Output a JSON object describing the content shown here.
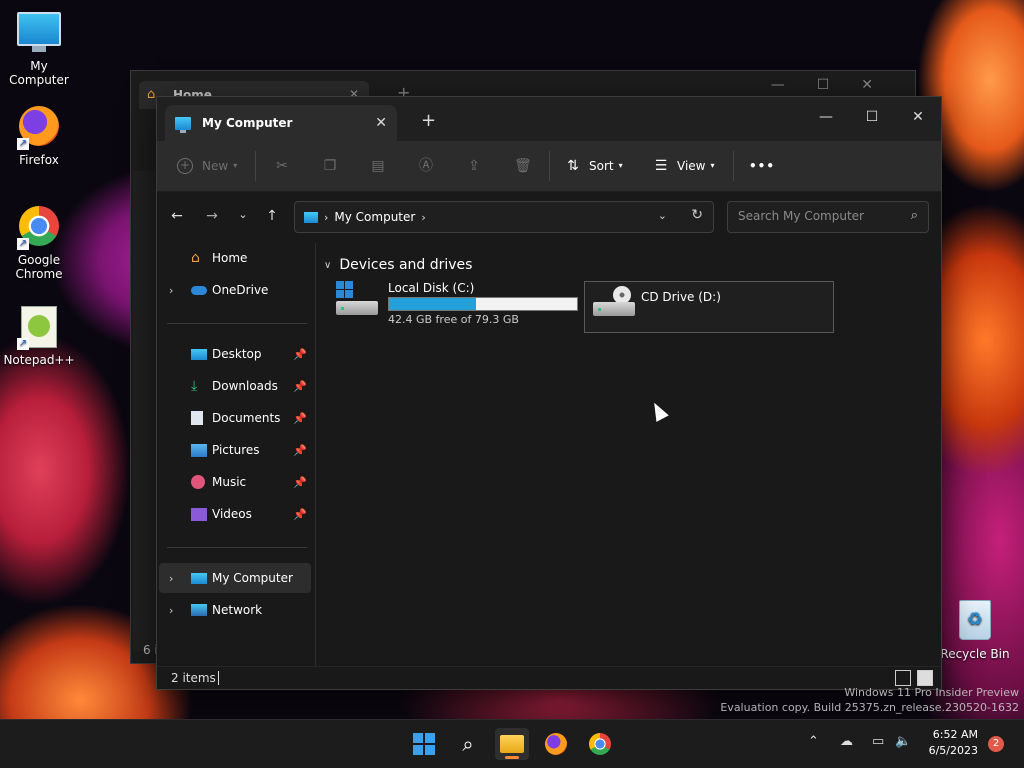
{
  "desktop": {
    "icons": [
      {
        "label": "My Computer"
      },
      {
        "label": "Firefox"
      },
      {
        "label": "Google Chrome"
      },
      {
        "label": "Notepad++"
      },
      {
        "label": "Recycle Bin"
      }
    ]
  },
  "back_window": {
    "tab_title": "Home",
    "status_partial": "6 i"
  },
  "window": {
    "tab_title": "My Computer",
    "new_tab": "+",
    "controls": {
      "minimize": "—",
      "maximize": "☐",
      "close": "✕"
    }
  },
  "toolbar": {
    "new_label": "New",
    "sort_label": "Sort",
    "view_label": "View",
    "more_label": "•••"
  },
  "navbar": {
    "breadcrumb": "My Computer",
    "search_placeholder": "Search My Computer"
  },
  "sidebar": {
    "items": [
      {
        "label": "Home",
        "icon": "home-icon"
      },
      {
        "label": "OneDrive",
        "icon": "cloud-icon"
      },
      {
        "label": "Desktop",
        "icon": "desktop-icon"
      },
      {
        "label": "Downloads",
        "icon": "download-icon"
      },
      {
        "label": "Documents",
        "icon": "document-icon"
      },
      {
        "label": "Pictures",
        "icon": "picture-icon"
      },
      {
        "label": "Music",
        "icon": "music-icon"
      },
      {
        "label": "Videos",
        "icon": "video-icon"
      },
      {
        "label": "My Computer",
        "icon": "computer-icon"
      },
      {
        "label": "Network",
        "icon": "network-icon"
      }
    ]
  },
  "content": {
    "group_title": "Devices and drives",
    "drives": [
      {
        "name": "Local Disk (C:)",
        "free_text": "42.4 GB free of 79.3 GB",
        "used_fraction": 0.465
      },
      {
        "name": "CD Drive (D:)"
      }
    ]
  },
  "statusbar": {
    "items_text": "2 items"
  },
  "watermark": {
    "line1": "Windows 11 Pro Insider Preview",
    "line2": "Evaluation copy. Build 25375.zn_release.230520-1632"
  },
  "taskbar": {
    "time": "6:52 AM",
    "date": "6/5/2023",
    "notifications": "2"
  },
  "colors": {
    "accent": "#26a0da",
    "window_bg": "#191919",
    "toolbar_bg": "#2c2c2c"
  }
}
